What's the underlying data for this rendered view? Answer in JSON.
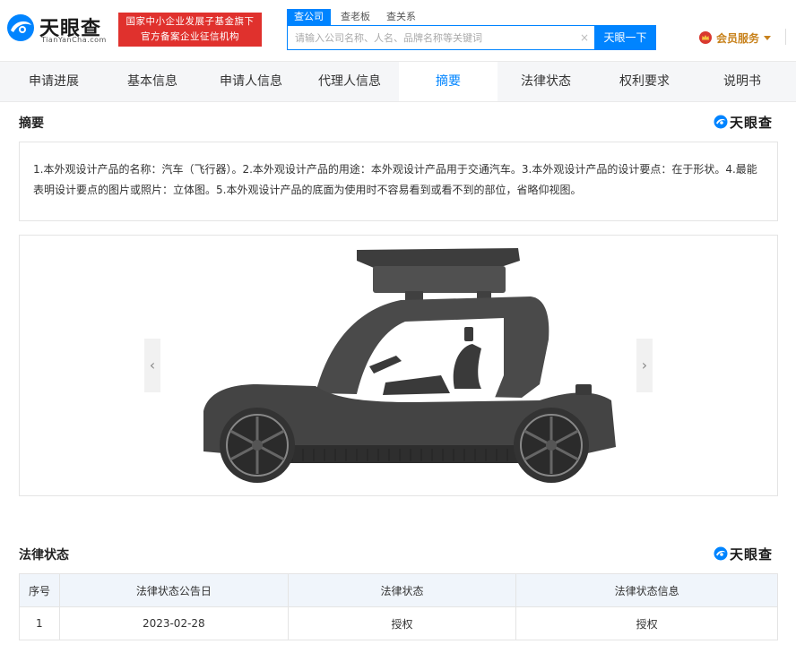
{
  "header": {
    "logo_name": "天眼查",
    "logo_pinyin": "TianYanCha.com",
    "slogan_line1": "国家中小企业发展子基金旗下",
    "slogan_line2": "官方备案企业征信机构",
    "search_tabs": [
      "查公司",
      "查老板",
      "查关系"
    ],
    "search_placeholder": "请输入公司名称、人名、品牌名称等关键词",
    "search_button": "天眼一下",
    "vip_label": "会员服务"
  },
  "nav": {
    "items": [
      "申请进展",
      "基本信息",
      "申请人信息",
      "代理人信息",
      "摘要",
      "法律状态",
      "权利要求",
      "说明书"
    ],
    "active": "摘要"
  },
  "abstract": {
    "title": "摘要",
    "brand": "天眼查",
    "text": "1.本外观设计产品的名称：汽车（飞行器）。2.本外观设计产品的用途：本外观设计产品用于交通汽车。3.本外观设计产品的设计要点：在于形状。4.最能表明设计要点的图片或照片：立体图。5.本外观设计产品的底面为使用时不容易看到或看不到的部位，省略仰视图。"
  },
  "viewer": {
    "prev_icon": "chevron-left-icon",
    "next_icon": "chevron-right-icon",
    "image": "flying-car-side-view"
  },
  "legal": {
    "title": "法律状态",
    "brand": "天眼查",
    "columns": [
      "序号",
      "法律状态公告日",
      "法律状态",
      "法律状态信息"
    ],
    "rows": [
      [
        "1",
        "2023-02-28",
        "授权",
        "授权"
      ]
    ]
  },
  "colors": {
    "accent": "#0084ff",
    "slogan_bg": "#e0312d",
    "vip": "#c8821c"
  }
}
